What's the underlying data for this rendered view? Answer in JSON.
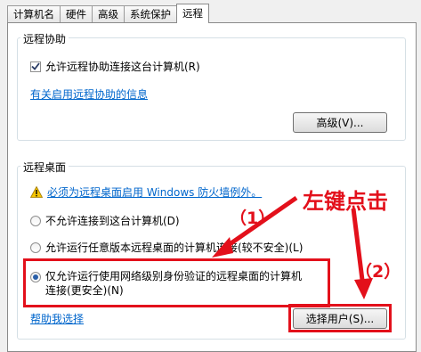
{
  "tabs": [
    {
      "label": "计算机名"
    },
    {
      "label": "硬件"
    },
    {
      "label": "高级"
    },
    {
      "label": "系统保护"
    },
    {
      "label": "远程"
    }
  ],
  "remote_assistance": {
    "legend": "远程协助",
    "allow_label": "允许远程协助连接这台计算机(R)",
    "allow_checked": true,
    "info_link": "有关启用远程协助的信息",
    "advanced_button": "高级(V)..."
  },
  "remote_desktop": {
    "legend": "远程桌面",
    "warning": "必须为远程桌面启用 Windows 防火墙例外。",
    "options": [
      {
        "label": "不允许连接到这台计算机(D)",
        "selected": false
      },
      {
        "label": "允许运行任意版本远程桌面的计算机连接(较不安全)(L)",
        "selected": false
      },
      {
        "label_line1": "仅允许运行使用网络级别身份验证的远程桌面的计算机",
        "label_line2": "连接(更安全)(N)",
        "selected": true
      }
    ],
    "help_link": "帮助我选择",
    "select_users_button": "选择用户(S)..."
  },
  "annotations": {
    "left_click": "左键点击",
    "step1": "（1）",
    "step2": "（2）",
    "color": "#e3101b"
  }
}
